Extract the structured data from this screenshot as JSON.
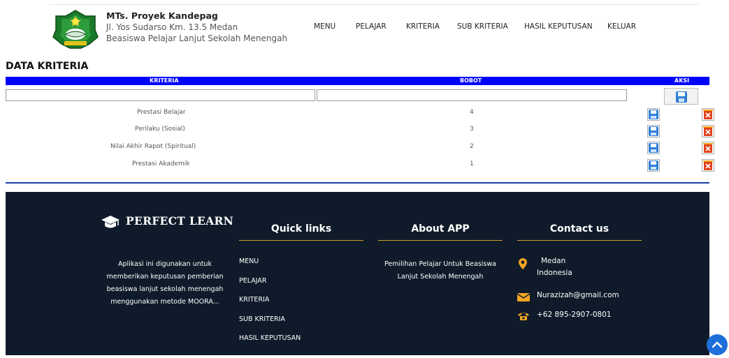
{
  "header": {
    "school_name": "MTs. Proyek Kandepag",
    "address": "Jl. Yos Sudarso Km. 13.5 Medan",
    "description": "Beasiswa Pelajar Lanjut Sekolah Menengah"
  },
  "nav": [
    "MENU",
    "PELAJAR",
    "KRITERIA",
    "SUB KRITERIA",
    "HASIL KEPUTUSAN",
    "KELUAR"
  ],
  "page_title": "DATA KRITERIA",
  "table": {
    "columns": [
      "KRITERIA",
      "BOBOT",
      "AKSI"
    ],
    "rows": [
      {
        "kriteria": "Prestasi Belajar",
        "bobot": "4"
      },
      {
        "kriteria": "Perilaku (Sosial)",
        "bobot": "3"
      },
      {
        "kriteria": "Nilai Akhir Rapot (Spiritual)",
        "bobot": "2"
      },
      {
        "kriteria": "Prestasi Akademik",
        "bobot": "1"
      }
    ]
  },
  "footer": {
    "brand": "PERFECT LEARN",
    "about": "Aplikasi ini digunakan untuk memberikan keputusan pemberian beasiswa lanjut sekolah menengah menggunakan metode MOORA...",
    "quick_links_title": "Quick links",
    "quick_links": [
      "MENU",
      "PELAJAR",
      "KRITERIA",
      "SUB KRITERIA",
      "HASIL KEPUTUSAN"
    ],
    "about_app_title": "About APP",
    "about_app_text": "Pemilihan Pelajar Untuk Beasiswa Lanjut Sekolah Menengah",
    "contact_title": "Contact us",
    "contact": {
      "city": "Medan",
      "country": "Indonesia",
      "email": "Nurazizah@gmail.com",
      "phone": "+62 895-2907-0801"
    }
  },
  "colors": {
    "table_header": "#0000ff",
    "footer_bg": "#0f1b2a",
    "footer_accent": "#c9a227",
    "scroll_top": "#1e6fd9"
  }
}
